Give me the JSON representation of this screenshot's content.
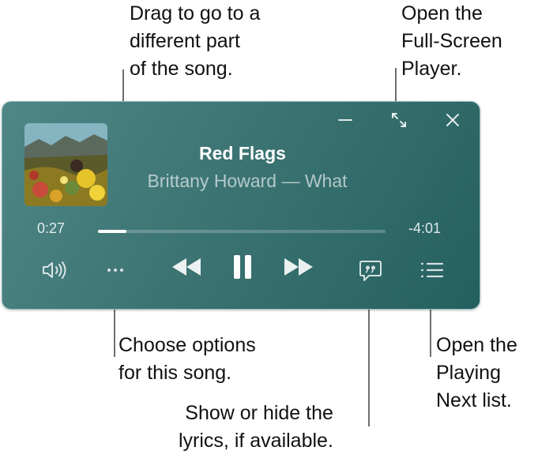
{
  "callouts": {
    "scrub": "Drag to go to a\ndifferent part\nof the song.",
    "fullscreen": "Open the\nFull-Screen\nPlayer.",
    "options": "Choose options\nfor this song.",
    "lyrics": "Show or hide the\nlyrics, if available.",
    "playing_next": "Open the\nPlaying\nNext list."
  },
  "player": {
    "title": "Red Flags",
    "artist_album": "Brittany Howard — What",
    "elapsed": "0:27",
    "remaining": "-4:01",
    "progress": 0.1
  },
  "icons": {
    "minimize": "minimize-icon",
    "fullscreen": "expand-arrows-icon",
    "close": "close-icon",
    "volume": "speaker-volume-icon",
    "more": "ellipsis-icon",
    "previous": "backward-icon",
    "pause": "pause-icon",
    "next": "forward-icon",
    "lyrics": "lyrics-quote-bubble-icon",
    "queue": "list-icon"
  },
  "colors": {
    "player_bg": "#3c7473",
    "text_primary": "#ffffff"
  }
}
